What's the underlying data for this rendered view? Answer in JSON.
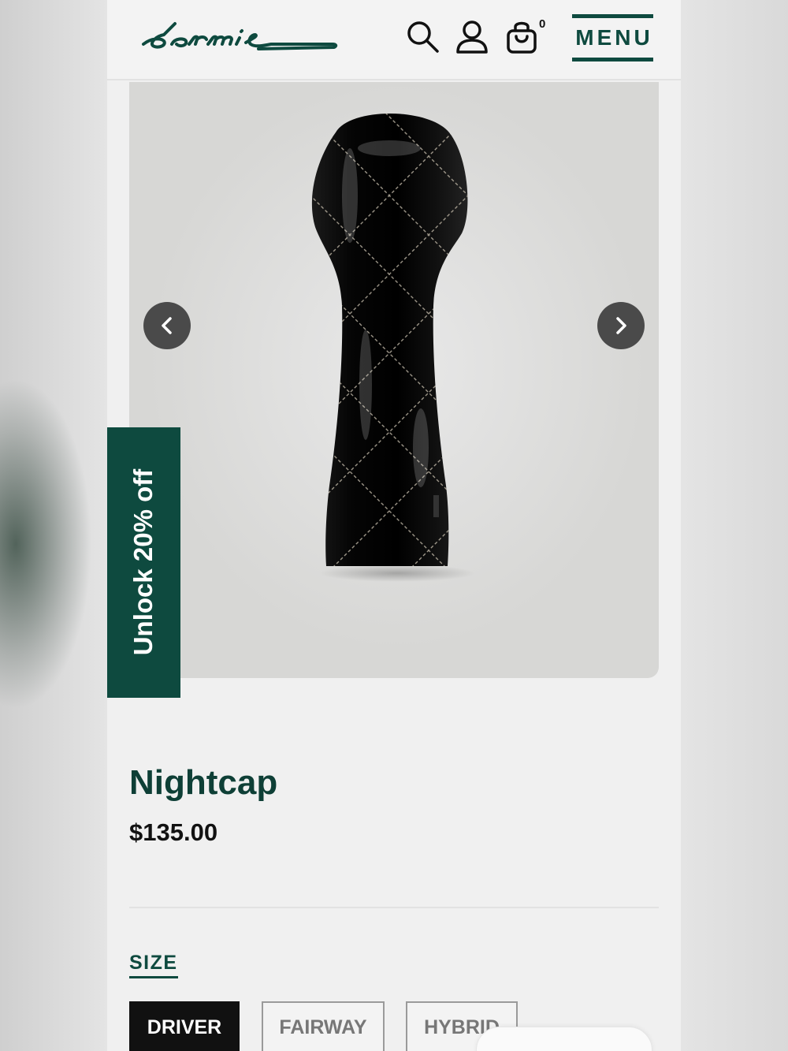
{
  "header": {
    "logo_text": "dormie",
    "cart_count": "0",
    "menu_label": "MENU"
  },
  "gallery": {
    "prev_icon": "chevron-left-icon",
    "next_icon": "chevron-right-icon"
  },
  "promo": {
    "label": "Unlock 20% off"
  },
  "product": {
    "title": "Nightcap",
    "price": "$135.00"
  },
  "size": {
    "label": "SIZE",
    "options": [
      "DRIVER",
      "FAIRWAY",
      "HYBRID"
    ],
    "selected": "DRIVER"
  },
  "colors": {
    "brand": "#0e4a3f",
    "selected_bg": "#111111"
  }
}
